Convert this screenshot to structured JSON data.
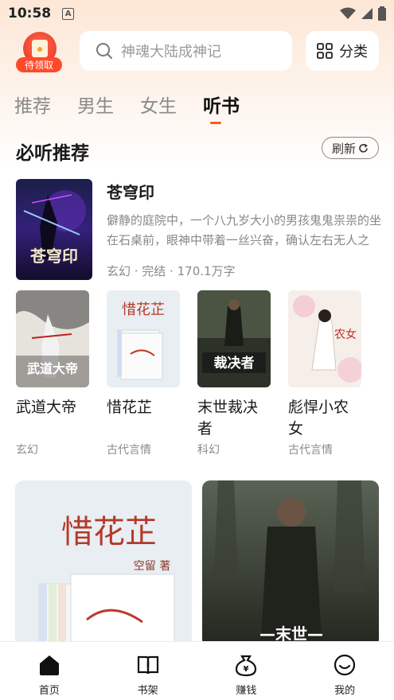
{
  "status": {
    "time": "10:58",
    "a_label": "A"
  },
  "header": {
    "reward_label": "待领取",
    "search_placeholder": "神魂大陆成神记",
    "category_label": "分类"
  },
  "tabs": [
    {
      "label": "推荐",
      "active": false
    },
    {
      "label": "男生",
      "active": false
    },
    {
      "label": "女生",
      "active": false
    },
    {
      "label": "听书",
      "active": true
    }
  ],
  "section": {
    "title": "必听推荐",
    "refresh_label": "刷新"
  },
  "featured": {
    "cover_text": "苍穹印",
    "title": "苍穹印",
    "description": "僻静的庭院中，一个八九岁大小的男孩鬼鬼祟祟的坐在石桌前，眼神中带着一丝兴奋，确认左右无人之",
    "meta": "玄幻 · 完结 · 170.1万字"
  },
  "grid_books": [
    {
      "title": "武道大帝",
      "genre": "玄幻",
      "cover_text": "武道大帝"
    },
    {
      "title": "惜花芷",
      "genre": "古代言情",
      "cover_text": "惜花芷"
    },
    {
      "title": "末世裁决者",
      "genre": "科幻",
      "cover_text": "裁决者"
    },
    {
      "title": "彪悍小农女",
      "genre": "古代言情",
      "cover_text": "农女"
    }
  ],
  "big_cards": [
    {
      "cover_text": "惜花芷",
      "author_text": "空留 著"
    },
    {
      "cover_text": "—末世—"
    }
  ],
  "nav": [
    {
      "label": "首页",
      "icon": "home-icon"
    },
    {
      "label": "书架",
      "icon": "bookshelf-icon"
    },
    {
      "label": "赚钱",
      "icon": "money-bag-icon"
    },
    {
      "label": "我的",
      "icon": "profile-icon"
    }
  ],
  "colors": {
    "accent": "#ff5a1e",
    "reward": "#ff4a2a"
  }
}
